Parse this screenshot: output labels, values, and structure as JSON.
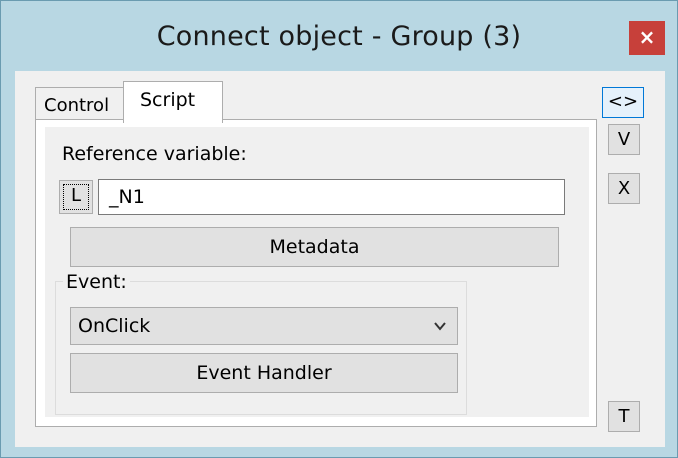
{
  "window": {
    "title": "Connect object - Group (3)",
    "close_label": "×"
  },
  "tabs": [
    {
      "label": "Control",
      "active": false
    },
    {
      "label": "Script",
      "active": true
    }
  ],
  "script": {
    "reference_label": "Reference variable:",
    "local_button": "L",
    "reference_value": "_N1",
    "metadata_button": "Metadata",
    "event_label": "Event:",
    "event_selected": "OnClick",
    "event_handler_button": "Event Handler"
  },
  "side_buttons": {
    "code": "<>",
    "v": "V",
    "x": "X",
    "t": "T"
  },
  "colors": {
    "frame": "#b8d7e3",
    "close": "#c7403a",
    "focus": "#0078d7"
  }
}
